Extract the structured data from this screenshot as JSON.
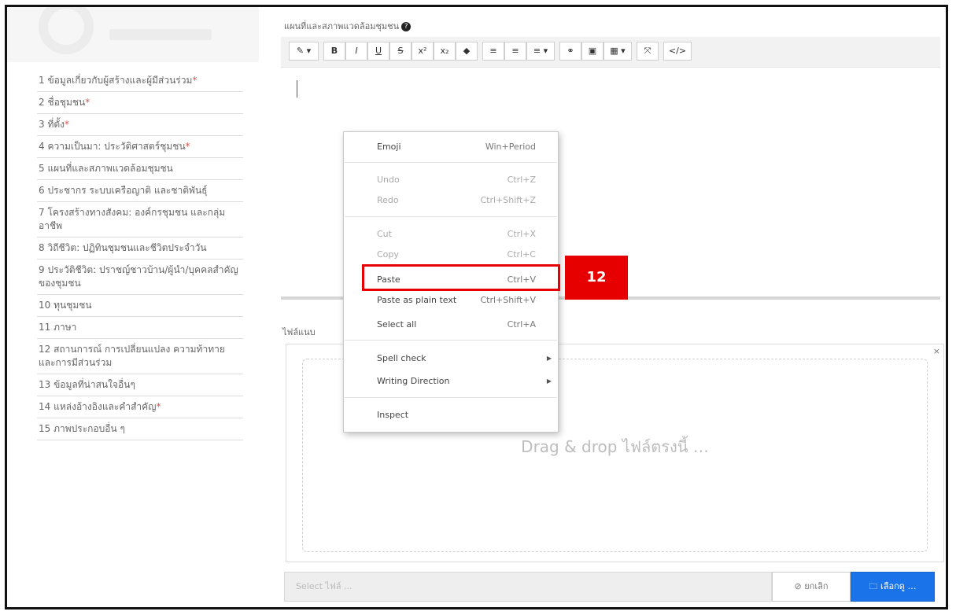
{
  "sidebar": {
    "items": [
      {
        "label": "1 ข้อมูลเกี่ยวกับผู้สร้างและผู้มีส่วนร่วม",
        "required": "*"
      },
      {
        "label": "2 ชื่อชุมชน",
        "required": "*"
      },
      {
        "label": "3 ที่ตั้ง",
        "required": "*"
      },
      {
        "label": "4 ความเป็นมา: ประวัติศาสตร์ชุมชน",
        "required": "*"
      },
      {
        "label": "5 แผนที่และสภาพแวดล้อมชุมชน",
        "required": ""
      },
      {
        "label": "6 ประชากร ระบบเครือญาติ และชาติพันธุ์",
        "required": ""
      },
      {
        "label": "7 โครงสร้างทางสังคม: องค์กรชุมชน และกลุ่มอาชีพ",
        "required": ""
      },
      {
        "label": "8 วิถีชีวิต: ปฏิทินชุมชนและชีวิตประจำวัน",
        "required": ""
      },
      {
        "label": "9 ประวัติชีวิต: ปราชญ์ชาวบ้าน/ผู้นำ/บุคคลสำคัญของชุมชน",
        "required": ""
      },
      {
        "label": "10 ทุนชุมชน",
        "required": ""
      },
      {
        "label": "11 ภาษา",
        "required": ""
      },
      {
        "label": "12 สถานการณ์ การเปลี่ยนแปลง ความท้าทาย และการมีส่วนร่วม",
        "required": ""
      },
      {
        "label": "13 ข้อมูลที่น่าสนใจอื่นๆ",
        "required": ""
      },
      {
        "label": "14 แหล่งอ้างอิงและคำสำคัญ",
        "required": "*"
      },
      {
        "label": "15 ภาพประกอบอื่น ๆ",
        "required": ""
      }
    ]
  },
  "editor": {
    "label": "แผนที่และสภาพแวดล้อมชุมชน",
    "help_icon": "?",
    "toolbar": {
      "magic": "✎ ▾",
      "bold": "B",
      "italic": "I",
      "underline": "U",
      "strike": "S",
      "superscript": "x²",
      "subscript": "x₂",
      "eraser": "◆",
      "ul": "≡",
      "ol": "≡",
      "align": "≡ ▾",
      "link": "⚭",
      "image": "▣",
      "table": "▦ ▾",
      "fullscreen": "⤧",
      "code": "</>"
    }
  },
  "context_menu": {
    "emoji": {
      "label": "Emoji",
      "shortcut": "Win+Period"
    },
    "undo": {
      "label": "Undo",
      "shortcut": "Ctrl+Z"
    },
    "redo": {
      "label": "Redo",
      "shortcut": "Ctrl+Shift+Z"
    },
    "cut": {
      "label": "Cut",
      "shortcut": "Ctrl+X"
    },
    "copy": {
      "label": "Copy",
      "shortcut": "Ctrl+C"
    },
    "paste": {
      "label": "Paste",
      "shortcut": "Ctrl+V"
    },
    "paste_plain": {
      "label": "Paste as plain text",
      "shortcut": "Ctrl+Shift+V"
    },
    "select_all": {
      "label": "Select all",
      "shortcut": "Ctrl+A"
    },
    "spell_check": {
      "label": "Spell check"
    },
    "writing_direction": {
      "label": "Writing Direction"
    },
    "inspect": {
      "label": "Inspect"
    }
  },
  "attachments": {
    "label": "ไฟล์แนบ",
    "close": "×",
    "drop_text": "Drag & drop ไฟล์ตรงนี้ …",
    "input_placeholder": "Select ไฟล์ ...",
    "cancel_label": "⊘ ยกเลิก",
    "browse_label": "🗀 เลือกดู …"
  },
  "annotation": {
    "step_number": "12",
    "color": "#e60000"
  }
}
